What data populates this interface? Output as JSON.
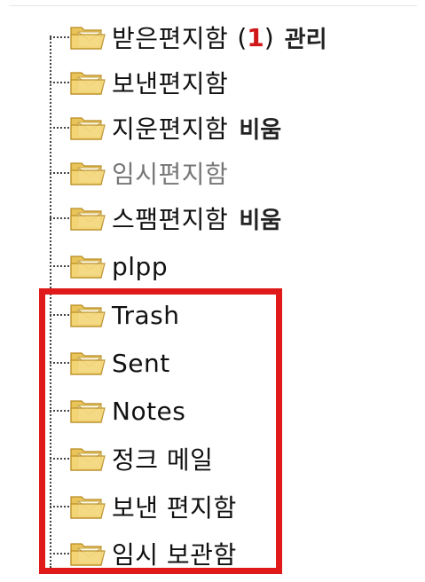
{
  "colors": {
    "highlight": "#e01a1a",
    "unread_count": "#d01818",
    "folder_body": "#f2cf6a"
  },
  "folders": [
    {
      "label": "받은편지함",
      "count_open": "(",
      "count": "1",
      "count_close": ")",
      "action": "관리",
      "icon": "folder-mail-icon"
    },
    {
      "label": "보낸편지함",
      "icon": "folder-mail-icon"
    },
    {
      "label": "지운편지함",
      "action": "비움",
      "icon": "folder-mail-icon"
    },
    {
      "label": "임시편지함",
      "muted": true,
      "icon": "folder-mail-icon"
    },
    {
      "label": "스팸편지함",
      "action": "비움",
      "icon": "folder-mail-icon"
    },
    {
      "label": "plpp",
      "icon": "folder-mail-icon"
    },
    {
      "label": "Trash",
      "icon": "folder-mail-icon"
    },
    {
      "label": "Sent",
      "icon": "folder-mail-icon"
    },
    {
      "label": "Notes",
      "icon": "folder-mail-icon"
    },
    {
      "label": "정크 메일",
      "icon": "folder-mail-icon"
    },
    {
      "label": "보낸 편지함",
      "icon": "folder-mail-icon"
    },
    {
      "label": "임시 보관함",
      "icon": "folder-mail-icon"
    }
  ]
}
